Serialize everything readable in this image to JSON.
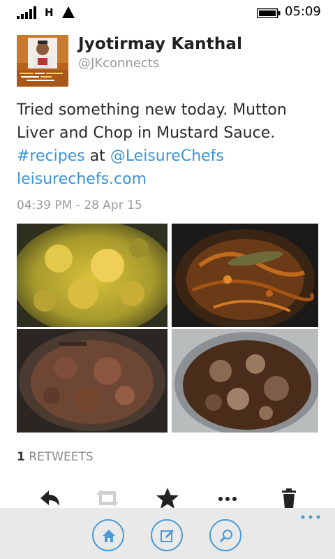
{
  "status_bar": {
    "network_type": "H",
    "time": "05:09"
  },
  "tweet": {
    "display_name": "Jyotirmay Kanthal",
    "handle": "@JKconnects",
    "text_line1": "Tried something new today. Mutton",
    "text_line2": "Liver and Chop in Mustard Sauce.",
    "hashtag": "#recipes",
    "at_word": "at",
    "mention": "@LeisureChefs",
    "url": "leisurechefs.com",
    "timestamp": "04:39 PM - 28 Apr 15",
    "retweet_count": "1",
    "retweet_label": "RETWEETS"
  },
  "photos": [
    {
      "name": "photo-1"
    },
    {
      "name": "photo-2"
    },
    {
      "name": "photo-3"
    },
    {
      "name": "photo-4"
    }
  ],
  "actions": [
    "reply-icon",
    "retweet-icon",
    "favorite-icon",
    "more-icon",
    "delete-icon"
  ],
  "app_bar": [
    "home-icon",
    "compose-icon",
    "search-icon"
  ],
  "colors": {
    "accent": "#4b9bd6",
    "link": "#3b94d9",
    "app_bar_bg": "#e9e9e9"
  }
}
